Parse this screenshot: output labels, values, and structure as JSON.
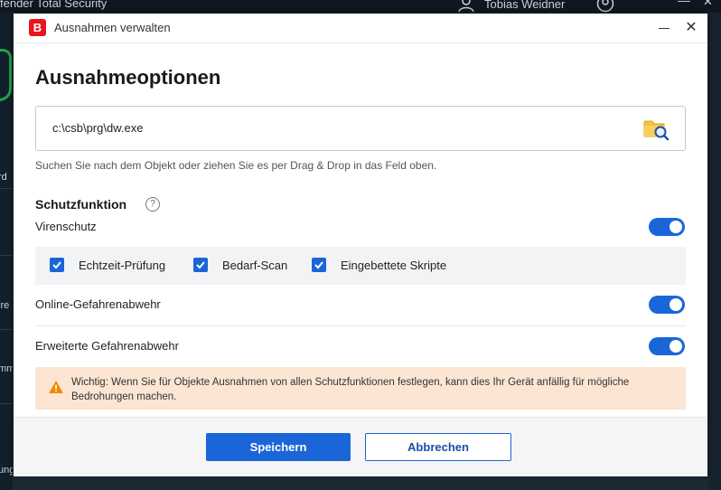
{
  "background_app": {
    "title": "fender Total Security",
    "user_name": "Tobias Weidner",
    "sidebar_items": [
      "rd",
      "ire",
      "mm",
      "ung"
    ]
  },
  "dialog": {
    "title": "Ausnahmen verwalten",
    "logo_letter": "B",
    "heading": "Ausnahmeoptionen",
    "path_value": "c:\\csb\\prg\\dw.exe",
    "hint": "Suchen Sie nach dem Objekt oder ziehen Sie es per Drag & Drop in das Feld oben.",
    "section_title": "Schutzfunktion",
    "help_symbol": "?",
    "rows": {
      "virus": {
        "label": "Virenschutz",
        "enabled": true
      },
      "online": {
        "label": "Online-Gefahrenabwehr",
        "enabled": true
      },
      "advanced": {
        "label": "Erweiterte Gefahrenabwehr",
        "enabled": true
      }
    },
    "checkboxes": [
      {
        "label": "Echtzeit-Prüfung",
        "checked": true
      },
      {
        "label": "Bedarf-Scan",
        "checked": true
      },
      {
        "label": "Eingebettete Skripte",
        "checked": true
      }
    ],
    "warning_text": "Wichtig: Wenn Sie für Objekte Ausnahmen von allen Schutzfunktionen festlegen, kann dies Ihr Gerät anfällig für mögliche Bedrohungen machen.",
    "buttons": {
      "save": "Speichern",
      "cancel": "Abbrechen"
    }
  },
  "colors": {
    "accent": "#1a66d9",
    "brand_red": "#e8141f",
    "warning_bg": "#fce6d3",
    "warning_icon": "#f08a00"
  }
}
